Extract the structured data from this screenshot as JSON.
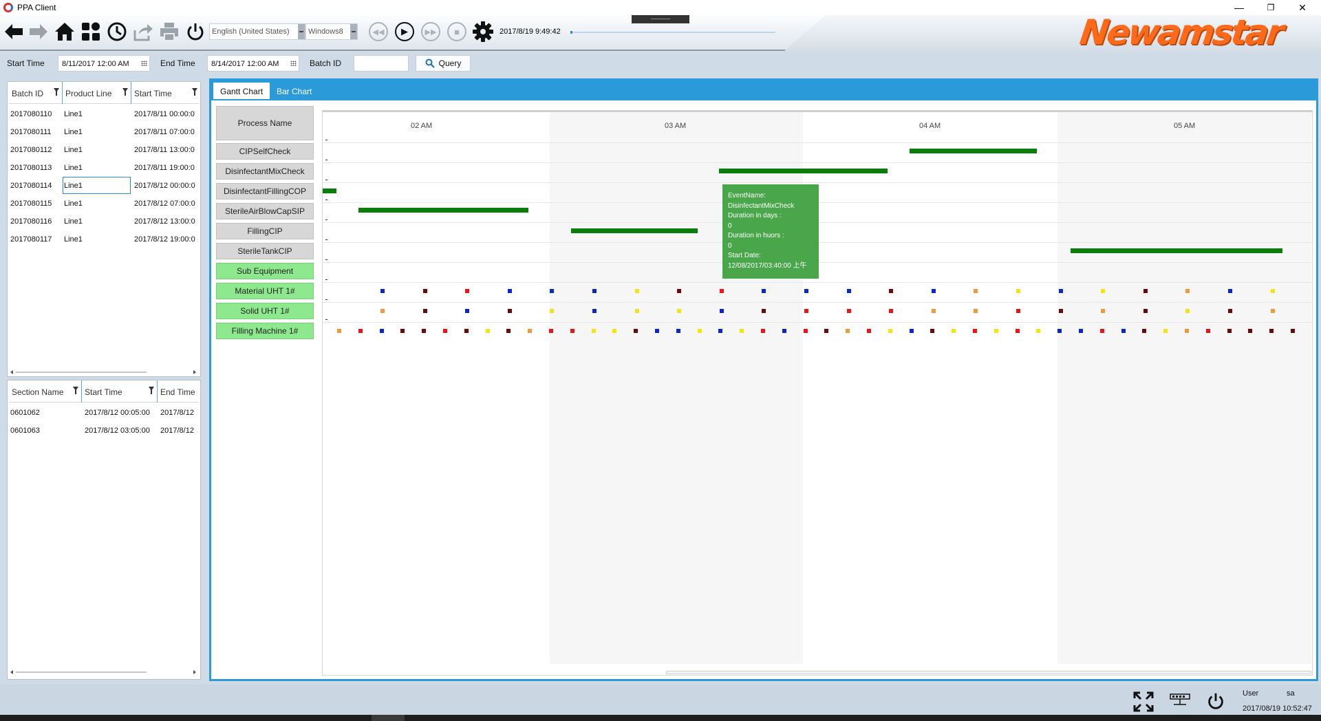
{
  "window": {
    "title": "PPA Client",
    "controls": {
      "minimize": "—",
      "restore": "❐",
      "close": "✕"
    }
  },
  "toolbar": {
    "icons": [
      "back-arrow-icon",
      "forward-arrow-icon",
      "home-icon",
      "dashboard-icon",
      "history-clock-icon",
      "export-icon",
      "print-icon",
      "power-icon"
    ],
    "language": "English (United States)",
    "theme": "Windows8",
    "playback": [
      "rewind",
      "play",
      "fast-forward",
      "stop"
    ],
    "playback_glyphs": {
      "rewind": "◀◀",
      "play": "▶",
      "fast_forward": "▶▶",
      "stop": "■"
    },
    "datetime": "2017/8/19 9:49:42",
    "progress": 0.01,
    "brand_text": "Newamstar",
    "brand_color": "#ff6a1a"
  },
  "filters": {
    "start_time_label": "Start Time",
    "start_time_value": "8/11/2017 12:00 AM",
    "end_time_label": "End Time",
    "end_time_value": "8/14/2017 12:00 AM",
    "batch_id_label": "Batch ID",
    "batch_id_value": "",
    "query_label": "Query"
  },
  "batch_grid": {
    "columns": [
      "Batch ID",
      "Product Line",
      "Start Time"
    ],
    "rows": [
      [
        "2017080110",
        "Line1",
        "2017/8/11 00:00:0"
      ],
      [
        "2017080111",
        "Line1",
        "2017/8/11 07:00:0"
      ],
      [
        "2017080112",
        "Line1",
        "2017/8/11 13:00:0"
      ],
      [
        "2017080113",
        "Line1",
        "2017/8/11 19:00:0"
      ],
      [
        "2017080114",
        "Line1",
        "2017/8/12 00:00:0"
      ],
      [
        "2017080115",
        "Line1",
        "2017/8/12 07:00:0"
      ],
      [
        "2017080116",
        "Line1",
        "2017/8/12 13:00:0"
      ],
      [
        "2017080117",
        "Line1",
        "2017/8/12 19:00:0"
      ]
    ],
    "selected_row": 4
  },
  "section_grid": {
    "columns": [
      "Section Name",
      "Start Time",
      "End Time"
    ],
    "rows": [
      [
        "0601062",
        "2017/8/12 00:05:00",
        "2017/8/12"
      ],
      [
        "0601063",
        "2017/8/12 03:05:00",
        "2017/8/12"
      ]
    ]
  },
  "tabs": [
    {
      "label": "Gantt Chart",
      "active": true
    },
    {
      "label": "Bar Chart",
      "active": false
    }
  ],
  "gantt": {
    "process_header": "Process Name",
    "processes": [
      "CIPSelfCheck",
      "DisinfectantMixCheck",
      "DisinfectantFillingCOP",
      "SterileAirBlowCapSIP",
      "FillingCIP",
      "SterileTankCIP"
    ],
    "equipment_header": "Sub Equipment",
    "equipment": [
      "Material UHT 1#",
      "Solid UHT 1#",
      "Filling Machine 1#"
    ],
    "hour_labels": [
      "02 AM",
      "03 AM",
      "04 AM",
      "05 AM"
    ],
    "bar_color": "#0a7d0a",
    "equipment_color": "#8ee88e",
    "colors": {
      "blue": "#0a28c8",
      "maroon": "#6a0a0a",
      "red": "#e81616",
      "yellow": "#f2e416",
      "orange": "#f29a3a"
    },
    "tooltip": {
      "lines": [
        "EventName:",
        "DisinfectantMixCheck",
        "Duration in days :",
        "0",
        "Duration in huors :",
        "0",
        "Start Date:",
        "12/08/2017/03:40:00 上午"
      ]
    }
  },
  "statusbar": {
    "icons": [
      "fullscreen-icon",
      "network-icon",
      "power-icon"
    ],
    "user_label": "User",
    "user_name": "sa",
    "datetime": "2017/08/19 10:52:47"
  }
}
